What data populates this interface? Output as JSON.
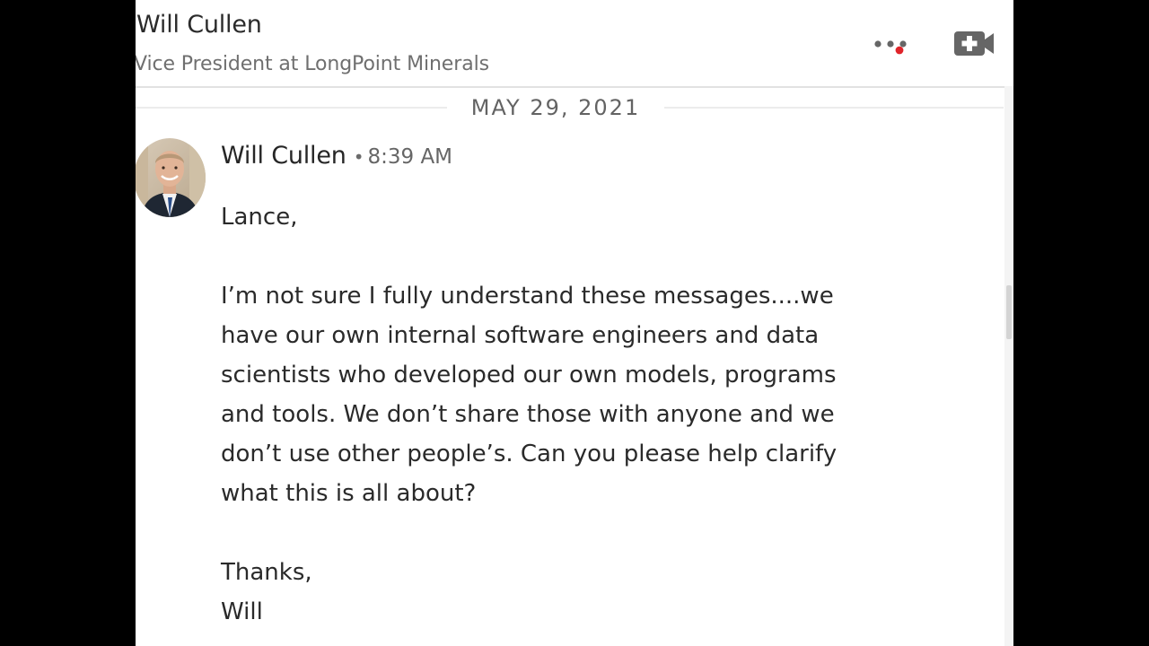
{
  "header": {
    "name": "Will Cullen",
    "headline": "Vice President at LongPoint Minerals",
    "more_icon": "more-dots-icon",
    "video_icon": "video-call-icon",
    "notification_color": "#e0242a"
  },
  "thread": {
    "date_divider": "MAY 29, 2021",
    "messages": [
      {
        "sender": "Will Cullen",
        "separator": "•",
        "time": "8:39 AM",
        "body": {
          "greeting": "Lance,",
          "paragraph_lines": [
            "I’m not sure I fully understand these messages....we",
            "have our own internal software engineers and data",
            "scientists who developed our own models, programs",
            "and tools. We don’t share those with anyone and we",
            "don’t use other people’s. Can you please help clarify",
            "what this is all about?"
          ],
          "closing": "Thanks,",
          "signature": "Will"
        }
      }
    ]
  }
}
